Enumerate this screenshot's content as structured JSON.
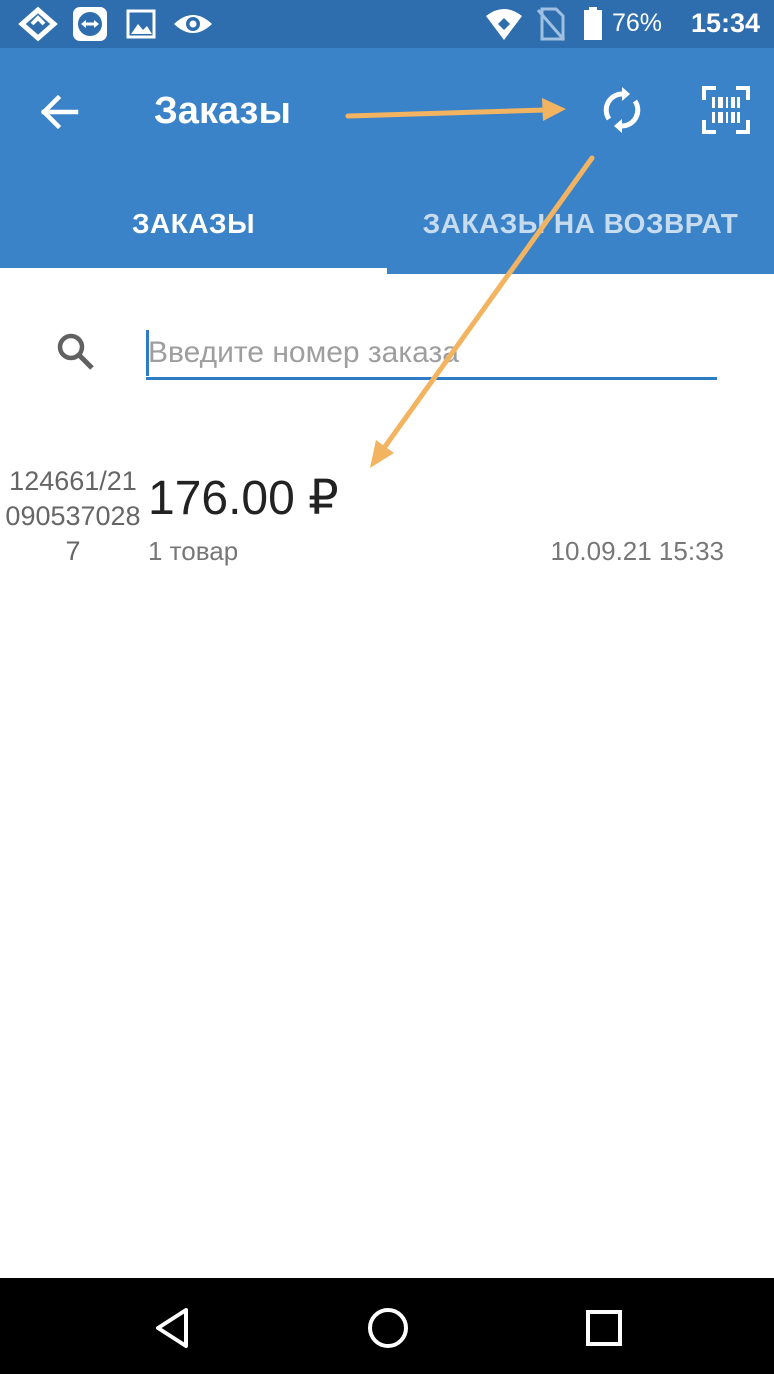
{
  "status_bar": {
    "battery_percent": "76%",
    "time": "15:34",
    "icons": [
      "location-diamond-icon",
      "teamviewer-icon",
      "image-icon",
      "eye-icon",
      "wifi-icon",
      "no-sim-icon",
      "battery-icon"
    ]
  },
  "app_bar": {
    "title": "Заказы",
    "icons": [
      "back-arrow-icon",
      "sync-icon",
      "barcode-scan-icon"
    ]
  },
  "tabs": [
    {
      "label": "ЗАКАЗЫ",
      "selected": true
    },
    {
      "label": "ЗАКАЗЫ НА ВОЗВРАТ",
      "selected": false
    }
  ],
  "search": {
    "placeholder": "Введите номер заказа",
    "value": ""
  },
  "orders": [
    {
      "number": "124661/210905370287",
      "amount": "176.00 ₽",
      "items_count": "1 товар",
      "date": "10.09.21 15:33"
    }
  ],
  "colors": {
    "status_bar": "#2f6eae",
    "app_bar": "#3b83c8",
    "accent": "#2f7cc6",
    "annotation_arrow": "#f2b460"
  }
}
